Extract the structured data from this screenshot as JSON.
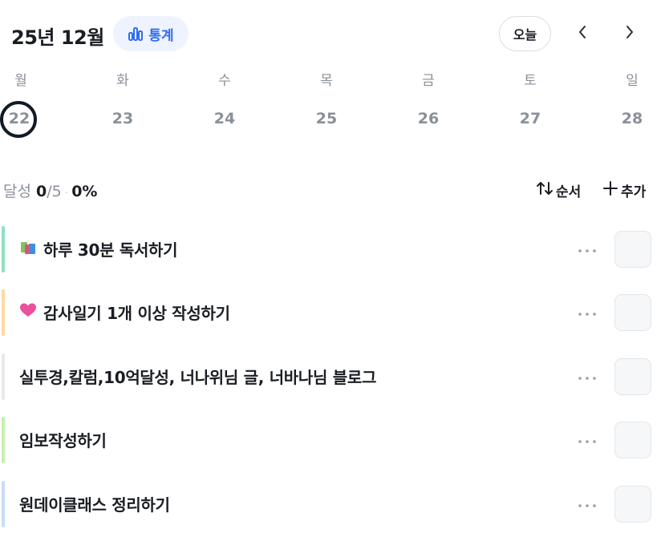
{
  "header": {
    "month_title": "25년 12월",
    "stats_label": "통계",
    "today_label": "오늘"
  },
  "week": {
    "days": [
      {
        "dow": "월",
        "date": "22",
        "is_today": true
      },
      {
        "dow": "화",
        "date": "23"
      },
      {
        "dow": "수",
        "date": "24"
      },
      {
        "dow": "목",
        "date": "25"
      },
      {
        "dow": "금",
        "date": "26"
      },
      {
        "dow": "토",
        "date": "27"
      },
      {
        "dow": "일",
        "date": "28"
      }
    ]
  },
  "summary": {
    "label": "달성",
    "done": "0",
    "total": "/5",
    "dot": "·",
    "percent": "0%"
  },
  "actions": {
    "sort_label": "순서",
    "add_label": "추가"
  },
  "tasks": [
    {
      "icon": "books-icon",
      "title": "하루 30분 독서하기",
      "color": "#8fe0bf"
    },
    {
      "icon": "heart-icon",
      "title": "감사일기 1개 이상 작성하기",
      "color": "#ffd9a6"
    },
    {
      "icon": "",
      "title": "실투경,칼럼,10억달성, 너나위님 글, 너바나님 블로그",
      "color": "#e6e8eb"
    },
    {
      "icon": "",
      "title": "임보작성하기",
      "color": "#c6efb0"
    },
    {
      "icon": "",
      "title": "원데이클래스 정리하기",
      "color": "#c7dcf6"
    }
  ],
  "colors": {
    "accent": "#2f6bf1",
    "accent_bg": "#eef3ff",
    "muted": "#8a9099",
    "today_ring": "#131a27"
  }
}
